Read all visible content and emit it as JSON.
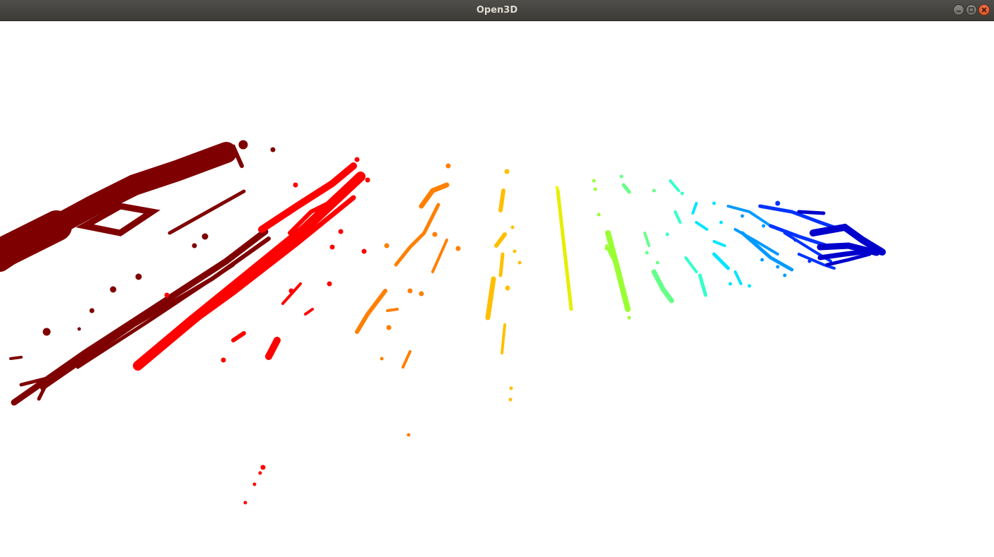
{
  "window": {
    "title": "Open3D",
    "controls": {
      "minimize_icon": "minimize-icon",
      "maximize_icon": "maximize-icon",
      "close_icon": "close-icon"
    }
  },
  "viewport": {
    "background": "#ffffff",
    "colormap": [
      "#7f0000",
      "#ff0000",
      "#ff7f00",
      "#ffbf00",
      "#ffff00",
      "#7fff3f",
      "#3fff9f",
      "#00ffff",
      "#0080ff",
      "#0000ff",
      "#00008f"
    ]
  }
}
